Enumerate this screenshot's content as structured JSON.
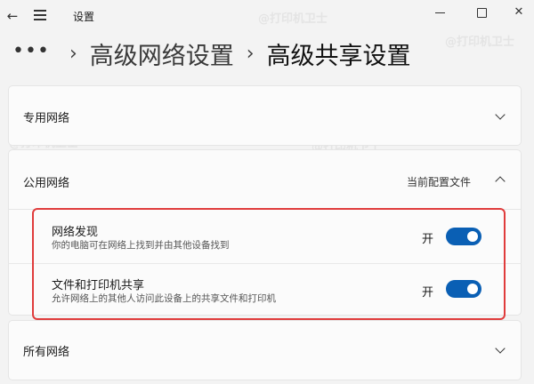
{
  "titlebar": {
    "back_icon": "back-arrow-icon",
    "menu_icon": "hamburger-icon",
    "title": "设置",
    "window_controls": [
      "minimize-icon",
      "maximize-icon",
      "close-icon"
    ]
  },
  "breadcrumb": {
    "more": "•••",
    "separator": "›",
    "parent": "高级网络设置",
    "current": "高级共享设置"
  },
  "sections": {
    "private": {
      "title": "专用网络",
      "expanded": false
    },
    "public": {
      "title": "公用网络",
      "expanded": true,
      "profile_label": "当前配置文件",
      "items": [
        {
          "title": "网络发现",
          "description": "你的电脑可在网络上找到并由其他设备找到",
          "toggle_label": "开",
          "on": true
        },
        {
          "title": "文件和打印机共享",
          "description": "允许网络上的其他人访问此设备上的共享文件和打印机",
          "toggle_label": "开",
          "on": true
        }
      ]
    },
    "all": {
      "title": "所有网络",
      "expanded": false
    }
  },
  "watermark": "@打印机卫士",
  "colors": {
    "accent": "#0a5fb4",
    "highlight": "#e03c3c"
  }
}
